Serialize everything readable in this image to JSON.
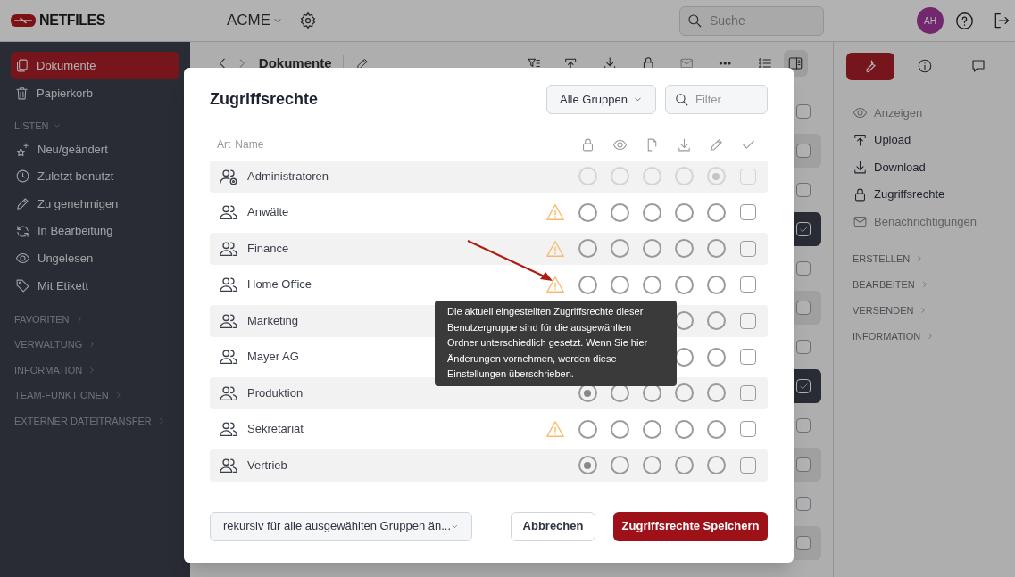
{
  "topbar": {
    "brand": "NETFILES",
    "workspace": "ACME",
    "search": {
      "placeholder": "Suche"
    },
    "avatar": "AH"
  },
  "sidebar": {
    "items": [
      {
        "label": "Dokumente",
        "kind": "documents",
        "selected": true
      },
      {
        "label": "Papierkorb",
        "kind": "trash",
        "selected": false
      }
    ],
    "lists": {
      "label": "LISTEN",
      "expanded": true,
      "items": [
        {
          "label": "Neu/geändert",
          "kind": "stars"
        },
        {
          "label": "Zuletzt benutzt",
          "kind": "clock"
        },
        {
          "label": "Zu genehmigen",
          "kind": "pencil"
        },
        {
          "label": "In Bearbeitung",
          "kind": "refresh"
        },
        {
          "label": "Ungelesen",
          "kind": "eye"
        },
        {
          "label": "Mit Etikett",
          "kind": "tag"
        }
      ]
    },
    "sections": [
      {
        "label": "FAVORITEN",
        "expanded": false
      },
      {
        "label": "VERWALTUNG",
        "expanded": false
      },
      {
        "label": "INFORMATION",
        "expanded": false
      },
      {
        "label": "TEAM-FUNKTIONEN",
        "expanded": false
      },
      {
        "label": "EXTERNER DATEITRANSFER",
        "expanded": false
      }
    ]
  },
  "main": {
    "breadcrumb": "Dokumente",
    "files": [
      {
        "selected": false
      },
      {
        "selected": false
      },
      {
        "selected": false
      },
      {
        "selected": true
      },
      {
        "selected": false
      },
      {
        "selected": false
      },
      {
        "selected": false
      },
      {
        "selected": true
      },
      {
        "selected": false
      },
      {
        "selected": false
      },
      {
        "selected": false
      },
      {
        "selected": false
      }
    ]
  },
  "right_panel": {
    "tabs": [
      {
        "kind": "tools",
        "selected": true
      },
      {
        "kind": "info",
        "selected": false
      },
      {
        "kind": "comment",
        "selected": false
      }
    ],
    "actions": [
      {
        "label": "Anzeigen",
        "kind": "eye",
        "disabled": true
      },
      {
        "label": "Upload",
        "kind": "upload",
        "disabled": false
      },
      {
        "label": "Download",
        "kind": "download",
        "disabled": false
      },
      {
        "label": "Zugriffsrechte",
        "kind": "lock",
        "disabled": false
      },
      {
        "label": "Benachrichtigungen",
        "kind": "mail",
        "disabled": true
      }
    ],
    "sections": [
      {
        "label": "ERSTELLEN",
        "expanded": false
      },
      {
        "label": "BEARBEITEN",
        "expanded": false
      },
      {
        "label": "VERSENDEN",
        "expanded": false
      },
      {
        "label": "INFORMATION",
        "expanded": false
      }
    ]
  },
  "dialog": {
    "title": "Zugriffsrechte",
    "group_filter": "Alle Gruppen",
    "filter": {
      "placeholder": "Filter"
    },
    "columns": [
      "Art",
      "Name"
    ],
    "rows": [
      {
        "name": "Administratoren",
        "kind": "admin",
        "warning": false,
        "disabled": true,
        "rights": [
          {
            "selected": false
          },
          {
            "selected": false
          },
          {
            "selected": false
          },
          {
            "selected": false
          },
          {
            "selected": true
          }
        ],
        "checked": false
      },
      {
        "name": "Anwälte",
        "kind": "group",
        "warning": true,
        "disabled": false,
        "rights": [
          {
            "selected": false
          },
          {
            "selected": false
          },
          {
            "selected": false
          },
          {
            "selected": false
          },
          {
            "selected": false
          }
        ],
        "checked": false
      },
      {
        "name": "Finance",
        "kind": "group",
        "warning": true,
        "disabled": false,
        "rights": [
          {
            "selected": false
          },
          {
            "selected": false
          },
          {
            "selected": false
          },
          {
            "selected": false
          },
          {
            "selected": false
          }
        ],
        "checked": false
      },
      {
        "name": "Home Office",
        "kind": "group",
        "warning": true,
        "disabled": false,
        "rights": [
          {
            "selected": false
          },
          {
            "selected": false
          },
          {
            "selected": false
          },
          {
            "selected": false
          },
          {
            "selected": false
          }
        ],
        "checked": false
      },
      {
        "name": "Marketing",
        "kind": "group",
        "disabled": false,
        "rights": [
          {
            "selected": false
          },
          {
            "selected": false
          }
        ],
        "checked": false
      },
      {
        "name": "Mayer AG",
        "kind": "group",
        "disabled": false,
        "rights": [
          {
            "selected": false
          },
          {
            "selected": false
          }
        ],
        "checked": false
      },
      {
        "name": "Produktion",
        "kind": "group",
        "warning": false,
        "disabled": false,
        "rights": [
          {
            "selected": true
          },
          {
            "selected": false
          },
          {
            "selected": false
          },
          {
            "selected": false
          },
          {
            "selected": false
          }
        ],
        "checked": false
      },
      {
        "name": "Sekretariat",
        "kind": "group",
        "warning": true,
        "disabled": false,
        "rights": [
          {
            "selected": false
          },
          {
            "selected": false
          },
          {
            "selected": false
          },
          {
            "selected": false
          },
          {
            "selected": false
          }
        ],
        "checked": false
      },
      {
        "name": "Vertrieb",
        "kind": "group",
        "warning": false,
        "disabled": false,
        "rights": [
          {
            "selected": true
          },
          {
            "selected": false
          },
          {
            "selected": false
          },
          {
            "selected": false
          },
          {
            "selected": false
          }
        ],
        "checked": false
      }
    ],
    "tooltip": "Die aktuell eingestellten Zugriffsrechte dieser Benutzergruppe sind für die ausgewählten Ordner unterschiedlich gesetzt. Wenn Sie hier Änderungen vornehmen, werden diese Einstellungen überschrieben.",
    "recursive_select": "rekursiv für alle ausgewählten Gruppen än...",
    "cancel": "Abbrechen",
    "save": "Zugriffsrechte Speichern"
  }
}
